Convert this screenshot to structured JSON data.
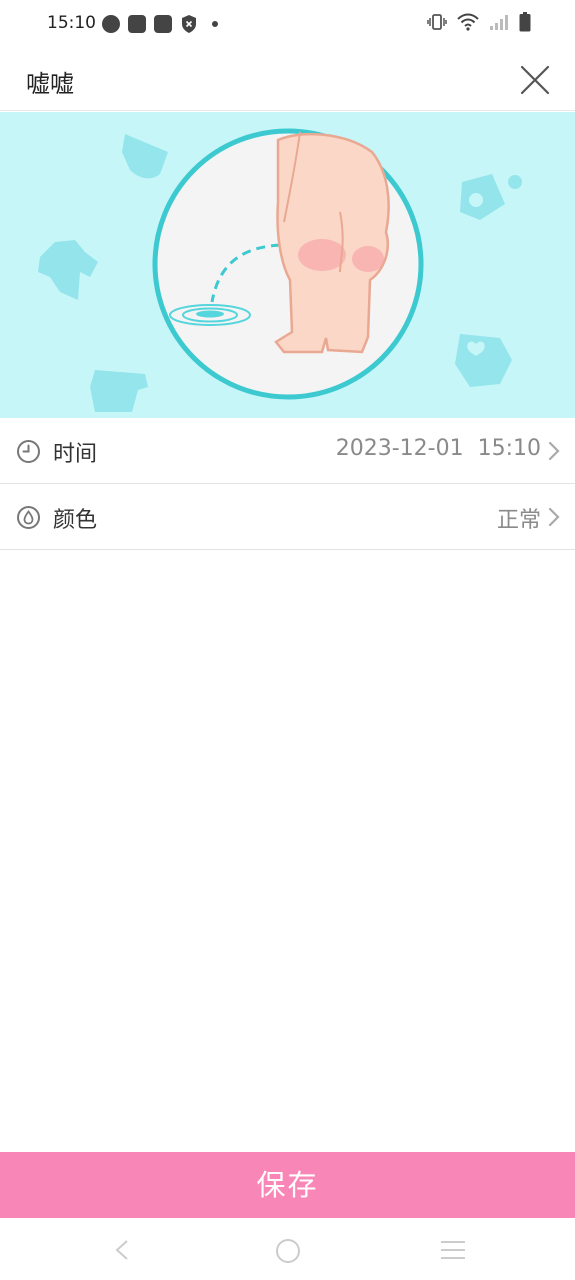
{
  "status_bar": {
    "time": "15:10"
  },
  "header": {
    "title": "嘘嘘"
  },
  "rows": [
    {
      "label": "时间",
      "value": "2023-12-01  15:10",
      "icon": "clock-icon"
    },
    {
      "label": "颜色",
      "value": "正常",
      "icon": "droplet-icon"
    }
  ],
  "save_label": "保存",
  "colors": {
    "accent": "#f887b7",
    "hero_bg": "#c6f6f8",
    "hero_ring": "#3cc9cf"
  }
}
